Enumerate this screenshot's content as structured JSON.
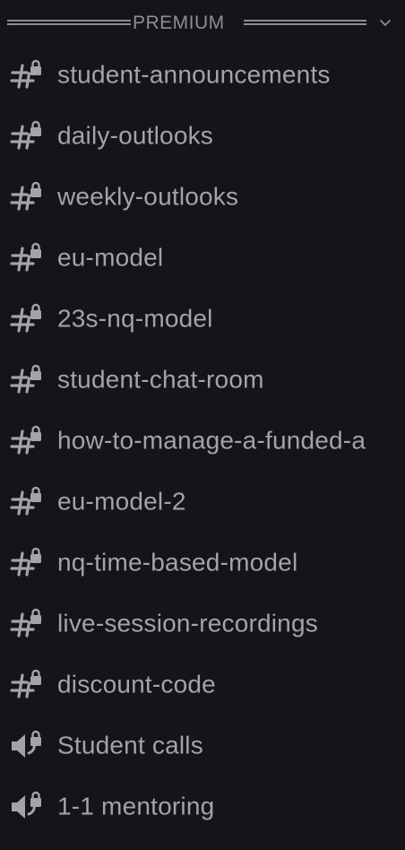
{
  "category": {
    "label": "PREMIUM",
    "icon": "chevron-down-icon"
  },
  "channels": [
    {
      "name": "student-announcements",
      "type": "text",
      "locked": true,
      "icon": "locked-text-channel-icon"
    },
    {
      "name": "daily-outlooks",
      "type": "text",
      "locked": true,
      "icon": "locked-text-channel-icon"
    },
    {
      "name": "weekly-outlooks",
      "type": "text",
      "locked": true,
      "icon": "locked-text-channel-icon"
    },
    {
      "name": "eu-model",
      "type": "text",
      "locked": true,
      "icon": "locked-text-channel-icon"
    },
    {
      "name": "23s-nq-model",
      "type": "text",
      "locked": true,
      "icon": "locked-text-channel-icon"
    },
    {
      "name": "student-chat-room",
      "type": "text",
      "locked": true,
      "icon": "locked-text-channel-icon"
    },
    {
      "name": "how-to-manage-a-funded-a",
      "type": "text",
      "locked": true,
      "icon": "locked-text-channel-icon"
    },
    {
      "name": "eu-model-2",
      "type": "text",
      "locked": true,
      "icon": "locked-text-channel-icon"
    },
    {
      "name": "nq-time-based-model",
      "type": "text",
      "locked": true,
      "icon": "locked-text-channel-icon"
    },
    {
      "name": "live-session-recordings",
      "type": "text",
      "locked": true,
      "icon": "locked-text-channel-icon"
    },
    {
      "name": "discount-code",
      "type": "text",
      "locked": true,
      "icon": "locked-text-channel-icon"
    },
    {
      "name": "Student calls",
      "type": "voice",
      "locked": true,
      "icon": "locked-voice-channel-icon"
    },
    {
      "name": "1-1 mentoring",
      "type": "voice",
      "locked": true,
      "icon": "locked-voice-channel-icon"
    }
  ],
  "colors": {
    "background": "#151419",
    "text": "#a4a2aa",
    "category": "#8e8c94"
  }
}
